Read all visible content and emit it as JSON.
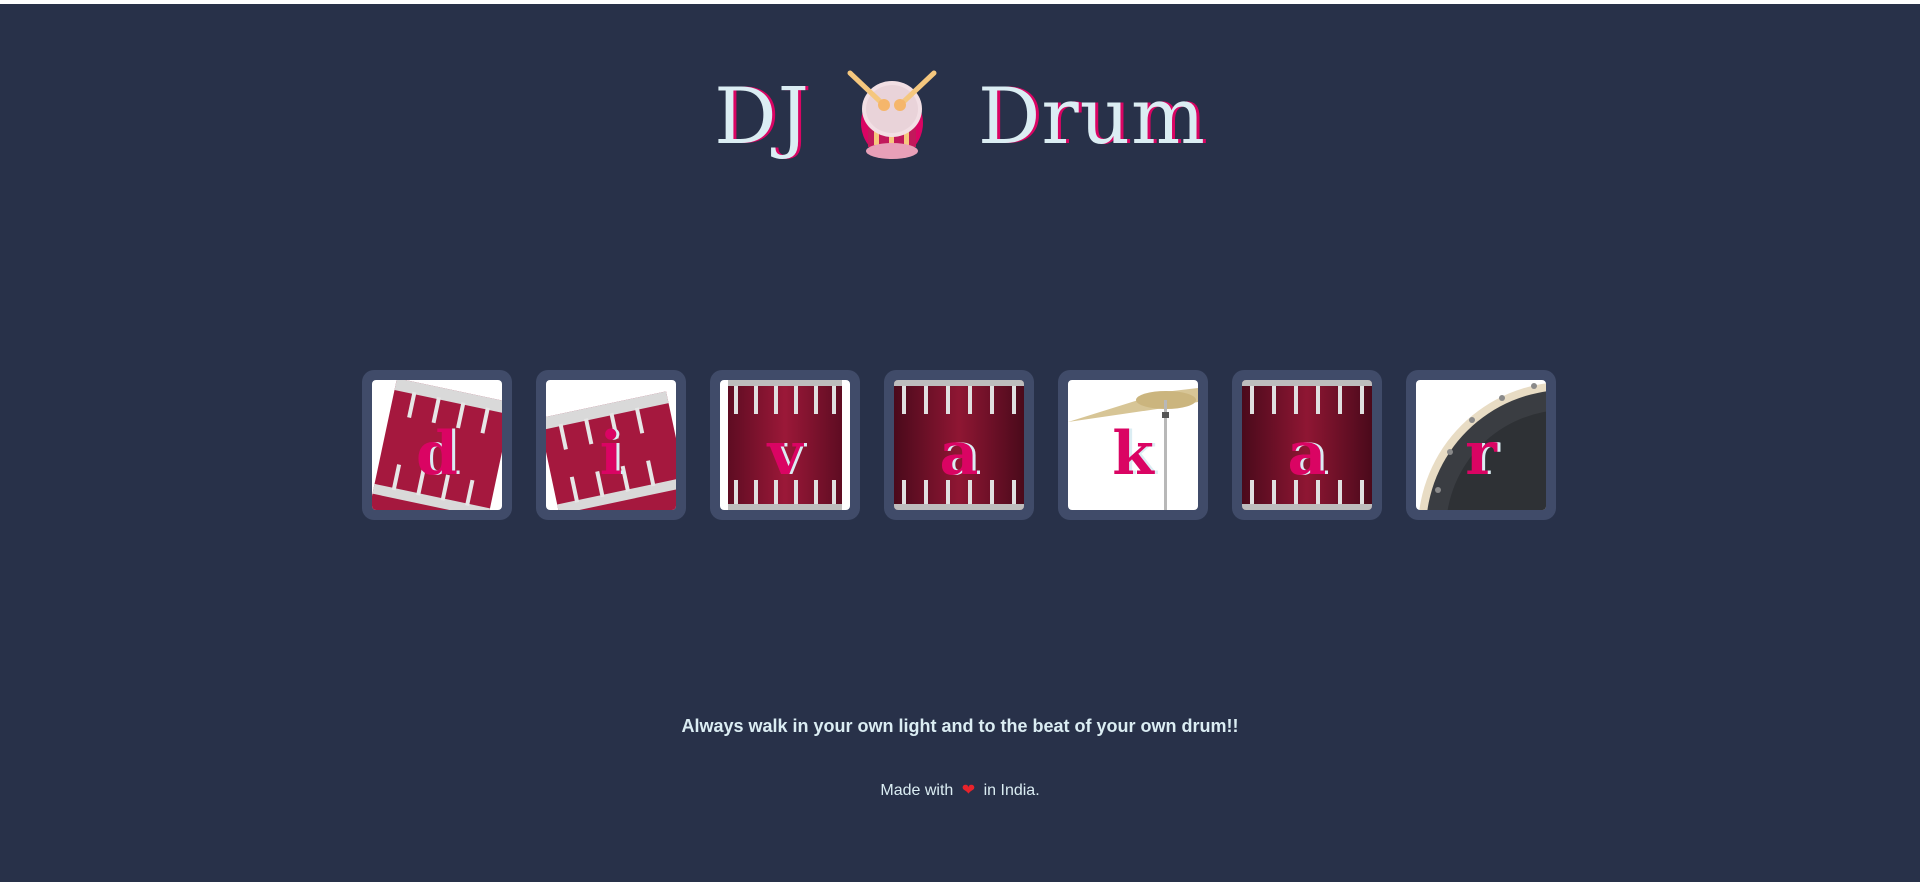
{
  "header": {
    "title_left": "DJ",
    "title_right": "Drum",
    "logo_icon": "drum-with-sticks-icon"
  },
  "drums": [
    {
      "letter": "d",
      "image": "tom-drum-tilted-left",
      "key": "d"
    },
    {
      "letter": "i",
      "image": "tom-drum-tilted-right",
      "key": "i"
    },
    {
      "letter": "v",
      "image": "floor-tom",
      "key": "v"
    },
    {
      "letter": "a",
      "image": "floor-tom",
      "key": "a"
    },
    {
      "letter": "k",
      "image": "crash-cymbal",
      "key": "k"
    },
    {
      "letter": "a",
      "image": "floor-tom",
      "key": "a"
    },
    {
      "letter": "r",
      "image": "kick-drum",
      "key": "r"
    }
  ],
  "tagline": "Always walk in your own light and to the beat of your own drum!!",
  "footer": {
    "prefix": "Made with",
    "heart_icon": "heart-icon",
    "suffix": "in India."
  },
  "colors": {
    "background": "#283149",
    "tile": "#404b69",
    "accent": "#da0463",
    "text": "#dbedf3",
    "heart": "#e8232b"
  }
}
